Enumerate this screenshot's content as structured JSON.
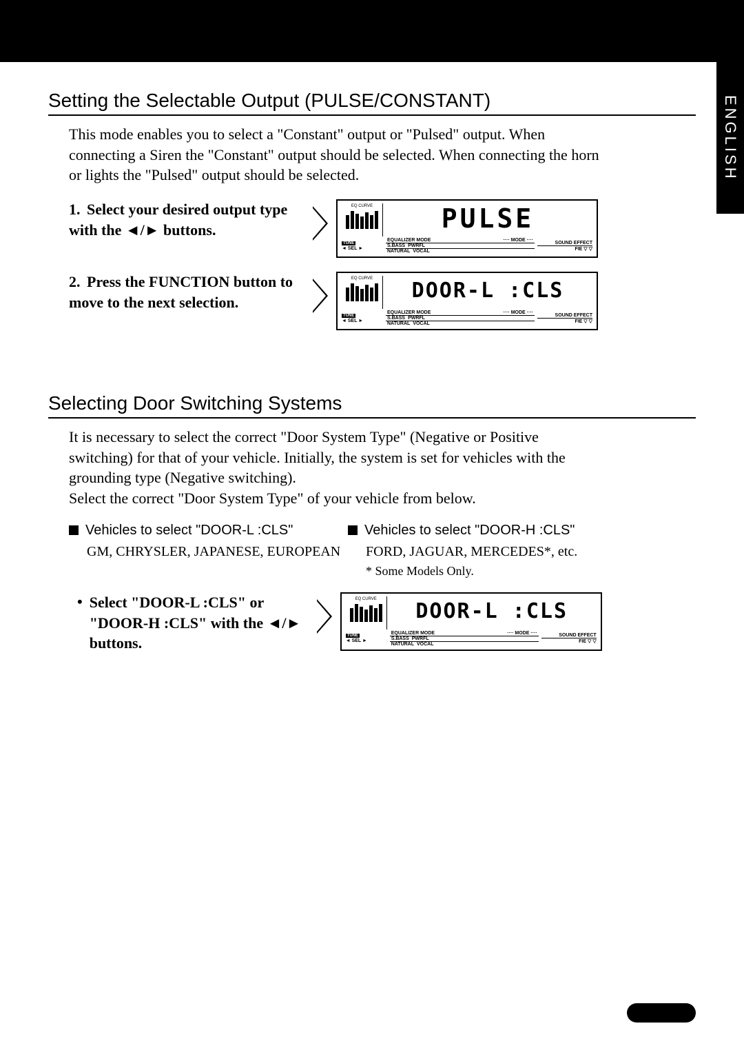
{
  "lang_tab": "ENGLISH",
  "section1": {
    "heading": "Setting the Selectable Output (PULSE/CONSTANT)",
    "intro": "This mode enables you to select a \"Constant\" output or \"Pulsed\" output. When connecting a Siren the \"Constant\" output should be selected. When connecting the horn or lights the \"Pulsed\" output should be selected.",
    "step1": {
      "num": "1.",
      "text": "Select your desired output type with the ◄/► buttons."
    },
    "step2": {
      "num": "2.",
      "text": "Press the FUNCTION button to move to the next selection."
    },
    "display1": "PULSE",
    "display2": "DOOR-L :CLS"
  },
  "section2": {
    "heading": "Selecting Door Switching Systems",
    "intro": "It is necessary to select the correct \"Door System Type\" (Negative or Positive switching) for that of your vehicle. Initially, the system is set for vehicles with the grounding type (Negative switching).\nSelect the correct \"Door System Type\" of your vehicle from below.",
    "colL": {
      "heading": "Vehicles to select \"DOOR-L :CLS\"",
      "body": "GM, CHRYSLER, JAPANESE, EUROPEAN"
    },
    "colR": {
      "heading": "Vehicles to select \"DOOR-H :CLS\"",
      "body": "FORD, JAGUAR, MERCEDES*, etc.",
      "footnote": "*  Some Models Only."
    },
    "bullet": "Select \"DOOR-L :CLS\" or \"DOOR-H :CLS\" with the ◄/► buttons.",
    "display": "DOOR-L :CLS"
  },
  "display_labels": {
    "eq": "EQ CURVE",
    "eqm": "EQUALIZER MODE",
    "mode": "···· MODE ····",
    "tune": "TUNE",
    "sel": "◄ SEL ►",
    "sbass": "S.BASS",
    "pwrfl": "PWRFL",
    "natural": "NATURAL",
    "vocal": "VOCAL",
    "sound": "SOUND EFFECT",
    "fie": "FIE  ▽  ▽"
  }
}
